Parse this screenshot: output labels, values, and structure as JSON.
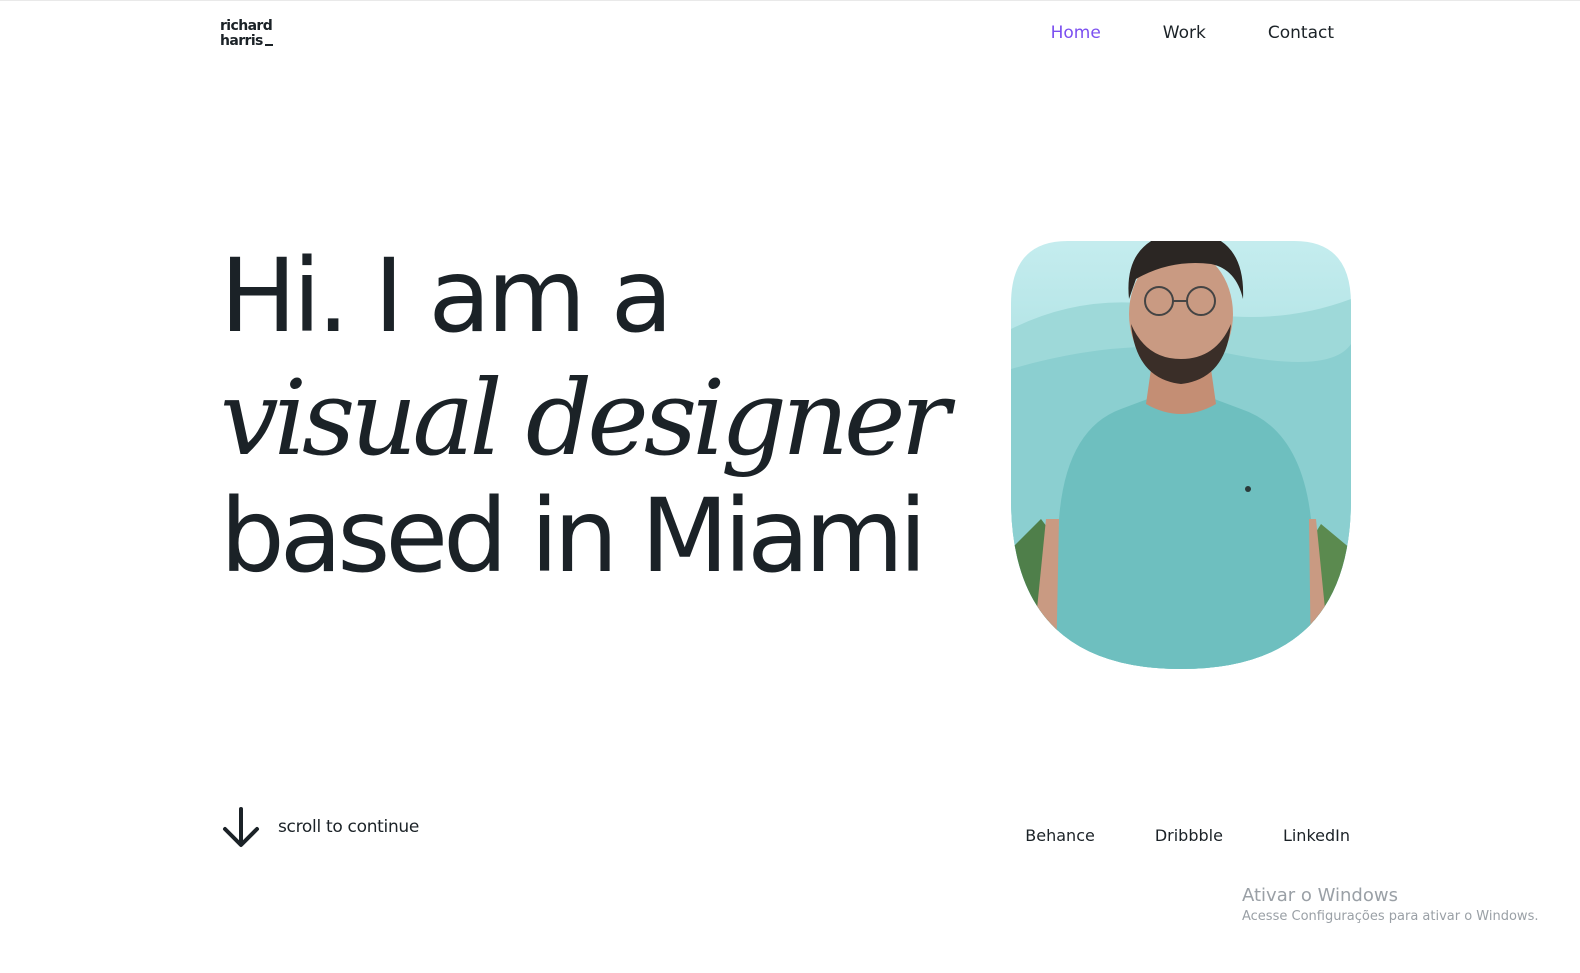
{
  "logo": {
    "line1": "richard",
    "line2": "harris"
  },
  "nav": {
    "items": [
      {
        "label": "Home",
        "active": true
      },
      {
        "label": "Work",
        "active": false
      },
      {
        "label": "Contact",
        "active": false
      }
    ]
  },
  "hero": {
    "line1": "Hi. I am a",
    "line2": "visual designer",
    "line3": "based in Miami"
  },
  "portrait": {
    "description_icon": "portrait-photo"
  },
  "scroll": {
    "label": "scroll to continue",
    "icon": "arrow-down-icon"
  },
  "social": {
    "items": [
      "Behance",
      "Dribbble",
      "LinkedIn"
    ]
  },
  "watermark": {
    "title": "Ativar o Windows",
    "subtitle": "Acesse Configurações para ativar o Windows."
  },
  "colors": {
    "accent": "#7b4ff0",
    "text": "#1b2227",
    "photo_bg": "#8fd6d6",
    "shirt": "#6bbcbc"
  }
}
